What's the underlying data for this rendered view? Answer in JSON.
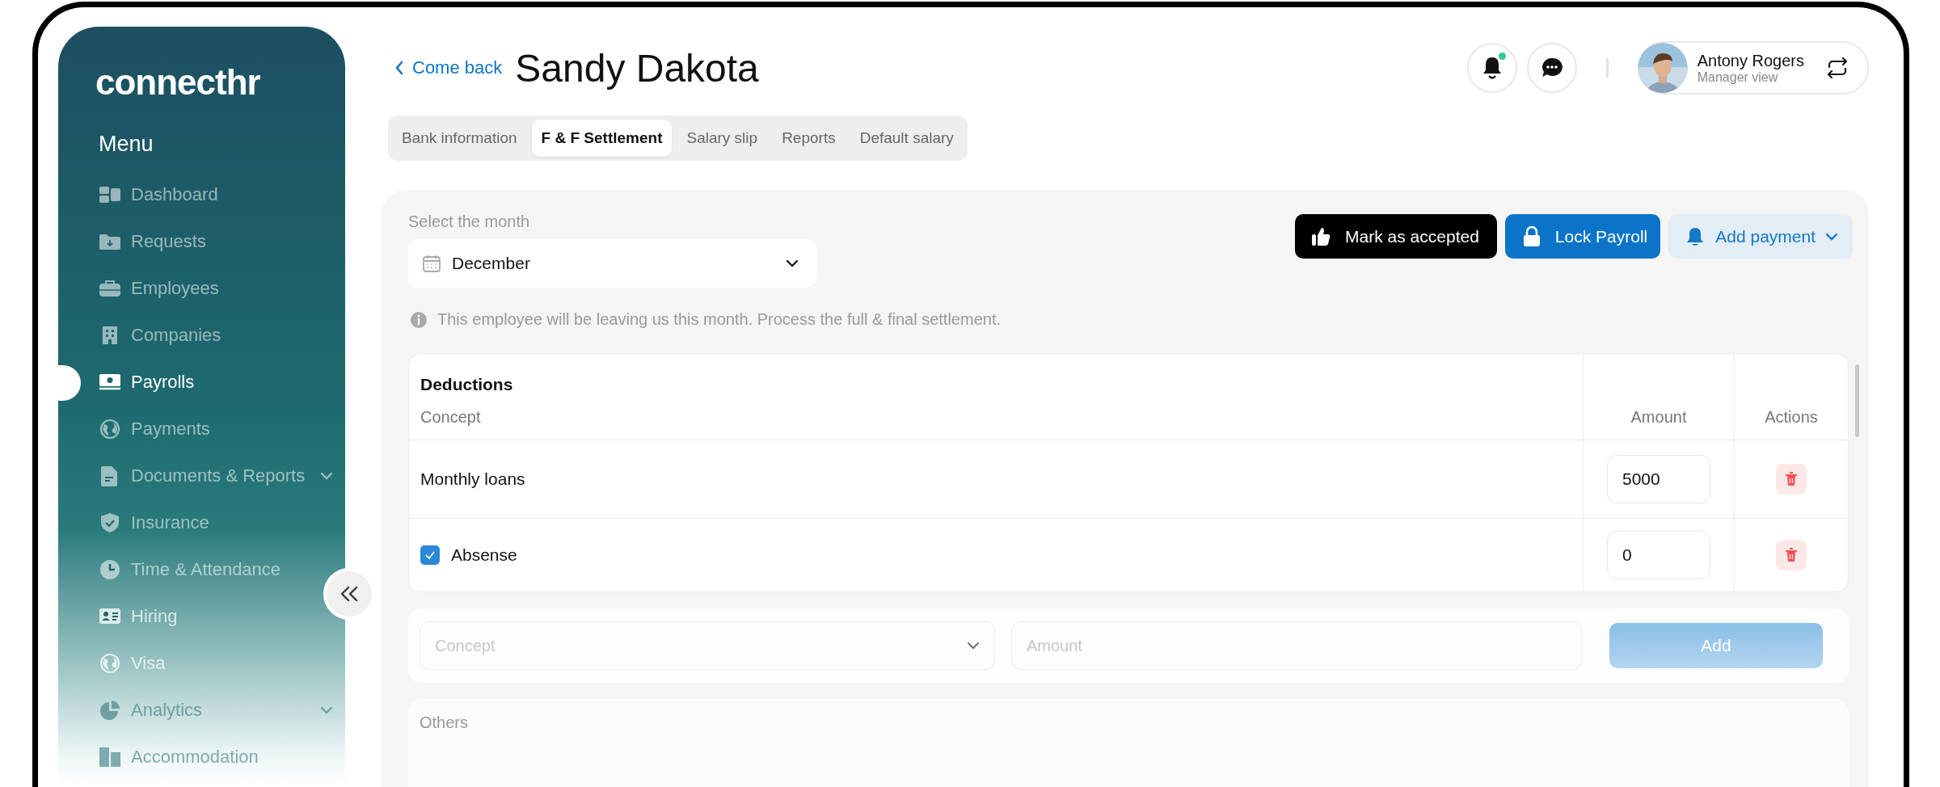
{
  "sidebar": {
    "logo": "connecthr",
    "menu_title": "Menu",
    "items": [
      {
        "label": "Dashboard",
        "selected": false,
        "expandable": false
      },
      {
        "label": "Requests",
        "selected": false,
        "expandable": false
      },
      {
        "label": "Employees",
        "selected": false,
        "expandable": false
      },
      {
        "label": "Companies",
        "selected": false,
        "expandable": false
      },
      {
        "label": "Payrolls",
        "selected": true,
        "expandable": false
      },
      {
        "label": "Payments",
        "selected": false,
        "expandable": false
      },
      {
        "label": "Documents & Reports",
        "selected": false,
        "expandable": true
      },
      {
        "label": "Insurance",
        "selected": false,
        "expandable": false
      },
      {
        "label": "Time & Attendance",
        "selected": false,
        "expandable": false
      },
      {
        "label": "Hiring",
        "selected": false,
        "expandable": false
      },
      {
        "label": "Visa",
        "selected": false,
        "expandable": false
      },
      {
        "label": "Analytics",
        "selected": false,
        "expandable": true
      },
      {
        "label": "Accommodation",
        "selected": false,
        "expandable": false
      }
    ]
  },
  "header": {
    "back_link": "Come back",
    "title": "Sandy Dakota",
    "notifications": {
      "unread": true
    },
    "user": {
      "name": "Antony Rogers",
      "role": "Manager view"
    }
  },
  "tabs": [
    {
      "label": "Bank information",
      "selected": false
    },
    {
      "label": "F & F Settlement",
      "selected": true
    },
    {
      "label": "Salary slip",
      "selected": false
    },
    {
      "label": "Reports",
      "selected": false
    },
    {
      "label": "Default salary",
      "selected": false
    }
  ],
  "month_select": {
    "label": "Select the month",
    "value": "December"
  },
  "actions": [
    {
      "label": "Mark as accepted",
      "kind": "dark"
    },
    {
      "label": "Lock Payroll",
      "kind": "primary"
    },
    {
      "label": "Add payment",
      "kind": "dropdown"
    }
  ],
  "notice": "This employee will be leaving us this month. Process the full & final settlement.",
  "deductions": {
    "title": "Deductions",
    "columns": [
      "Concept",
      "Amount",
      "Actions"
    ],
    "rows": [
      {
        "kind": "plain",
        "concept": "Monthly loans",
        "amount": "5000"
      },
      {
        "kind": "checkbox",
        "checked": true,
        "concept": "Absense",
        "amount": "0"
      }
    ]
  },
  "add_form": {
    "concept_placeholder": "Concept",
    "amount_placeholder": "Amount",
    "button": "Add"
  },
  "others": {
    "title": "Others"
  }
}
